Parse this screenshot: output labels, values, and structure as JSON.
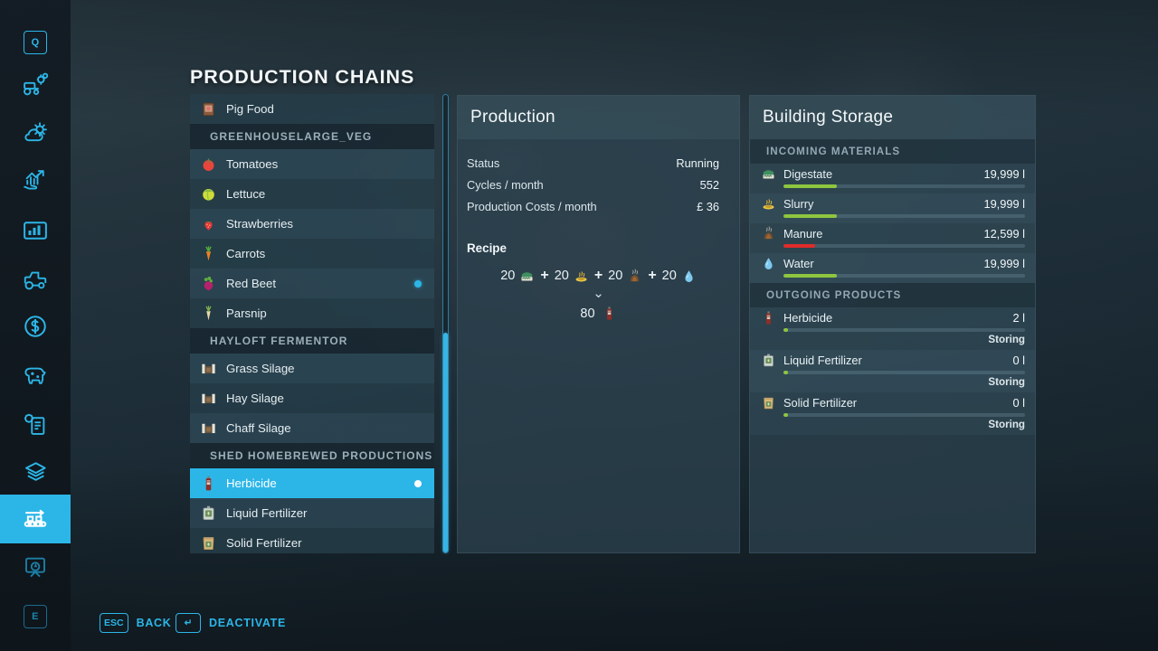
{
  "page_title": "PRODUCTION CHAINS",
  "sidebar": {
    "items": [
      {
        "name": "help-key",
        "label": "Q",
        "type": "keycap"
      },
      {
        "name": "vehicle-settings-icon",
        "label": "vehicle-settings-icon"
      },
      {
        "name": "weather-icon",
        "label": "weather-icon"
      },
      {
        "name": "prices-icon",
        "label": "prices-icon"
      },
      {
        "name": "statistics-icon",
        "label": "statistics-icon"
      },
      {
        "name": "vehicles-icon",
        "label": "vehicles-icon"
      },
      {
        "name": "finances-icon",
        "label": "finances-icon"
      },
      {
        "name": "animals-icon",
        "label": "animals-icon"
      },
      {
        "name": "contracts-icon",
        "label": "contracts-icon"
      },
      {
        "name": "documents-icon",
        "label": "documents-icon"
      },
      {
        "name": "production-icon",
        "label": "production-icon",
        "active": true
      },
      {
        "name": "map-overview-icon",
        "label": "map-overview-icon"
      }
    ],
    "bottom_key": "E"
  },
  "list": {
    "rows": [
      {
        "type": "item",
        "label": "Pig Food",
        "icon": "pig-food-icon"
      },
      {
        "type": "group",
        "label": "GREENHOUSELARGE_VEG"
      },
      {
        "type": "item",
        "label": "Tomatoes",
        "icon": "tomato-icon"
      },
      {
        "type": "item",
        "label": "Lettuce",
        "icon": "lettuce-icon"
      },
      {
        "type": "item",
        "label": "Strawberries",
        "icon": "strawberry-icon"
      },
      {
        "type": "item",
        "label": "Carrots",
        "icon": "carrot-icon"
      },
      {
        "type": "item",
        "label": "Red Beet",
        "icon": "red-beet-icon",
        "dot": true
      },
      {
        "type": "item",
        "label": "Parsnip",
        "icon": "parsnip-icon"
      },
      {
        "type": "group",
        "label": "HAYLOFT FERMENTOR"
      },
      {
        "type": "item",
        "label": "Grass Silage",
        "icon": "silage-icon"
      },
      {
        "type": "item",
        "label": "Hay Silage",
        "icon": "silage-icon"
      },
      {
        "type": "item",
        "label": "Chaff Silage",
        "icon": "silage-icon"
      },
      {
        "type": "group",
        "label": "SHED HOMEBREWED PRODUCTIONS"
      },
      {
        "type": "item",
        "label": "Herbicide",
        "icon": "herbicide-icon",
        "dot": true,
        "selected": true
      },
      {
        "type": "item",
        "label": "Liquid Fertilizer",
        "icon": "liquid-fertilizer-icon"
      },
      {
        "type": "item",
        "label": "Solid Fertilizer",
        "icon": "solid-fertilizer-icon"
      }
    ]
  },
  "production": {
    "title": "Production",
    "stats": [
      {
        "label": "Status",
        "value": "Running"
      },
      {
        "label": "Cycles / month",
        "value": "552"
      },
      {
        "label": "Production Costs / month",
        "value": "£ 36"
      }
    ],
    "recipe_label": "Recipe",
    "recipe_inputs": [
      {
        "amount": "20",
        "icon": "digestate-icon"
      },
      {
        "amount": "20",
        "icon": "slurry-icon"
      },
      {
        "amount": "20",
        "icon": "manure-icon"
      },
      {
        "amount": "20",
        "icon": "water-icon"
      }
    ],
    "recipe_plus": "+",
    "recipe_arrow": "⌄",
    "recipe_output": {
      "amount": "80",
      "icon": "herbicide-icon"
    }
  },
  "storage": {
    "title": "Building Storage",
    "incoming_header": "INCOMING MATERIALS",
    "outgoing_header": "OUTGOING PRODUCTS",
    "incoming": [
      {
        "name": "Digestate",
        "qty": "19,999 l",
        "icon": "digestate-icon",
        "fill": 22,
        "color": "#8ec63f"
      },
      {
        "name": "Slurry",
        "qty": "19,999 l",
        "icon": "slurry-icon",
        "fill": 22,
        "color": "#8ec63f"
      },
      {
        "name": "Manure",
        "qty": "12,599 l",
        "icon": "manure-icon",
        "fill": 13,
        "color": "#e02b2b"
      },
      {
        "name": "Water",
        "qty": "19,999 l",
        "icon": "water-icon",
        "fill": 22,
        "color": "#8ec63f"
      }
    ],
    "outgoing": [
      {
        "name": "Herbicide",
        "qty": "2 l",
        "icon": "herbicide-icon",
        "fill": 2,
        "color": "#8ec63f",
        "status": "Storing"
      },
      {
        "name": "Liquid Fertilizer",
        "qty": "0 l",
        "icon": "liquid-fertilizer-icon",
        "fill": 2,
        "color": "#8ec63f",
        "status": "Storing"
      },
      {
        "name": "Solid Fertilizer",
        "qty": "0 l",
        "icon": "solid-fertilizer-icon",
        "fill": 2,
        "color": "#8ec63f",
        "status": "Storing"
      }
    ]
  },
  "actions": {
    "back": {
      "key": "ESC",
      "label": "BACK"
    },
    "deactivate": {
      "key": "↵",
      "label": "DEACTIVATE"
    }
  }
}
